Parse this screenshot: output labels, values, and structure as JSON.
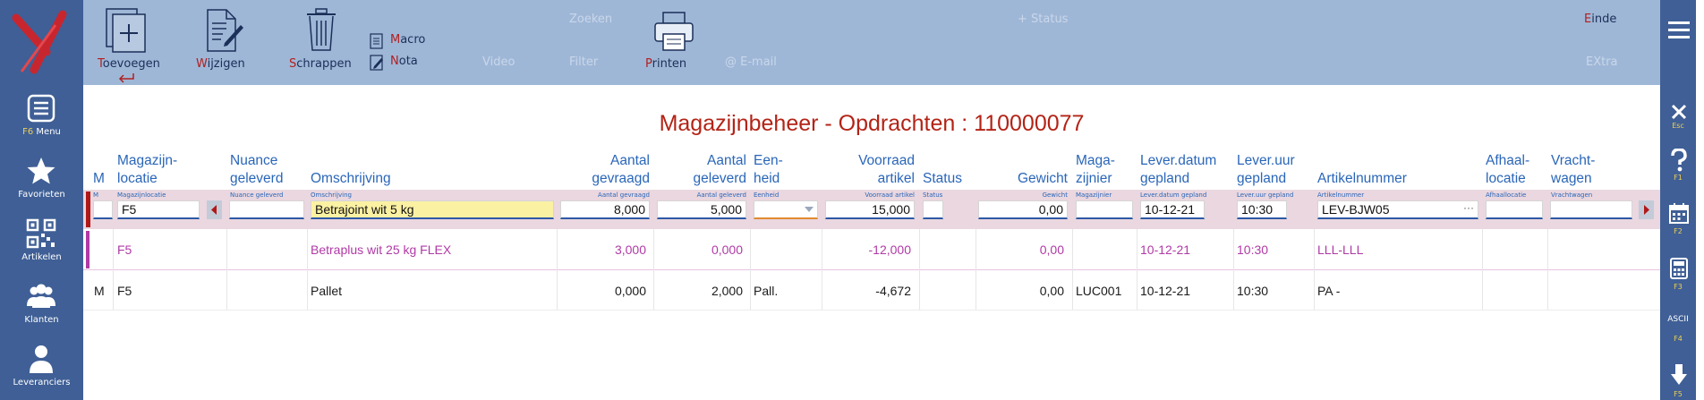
{
  "toolbar": {
    "toevoegen": "Toevoegen",
    "wijzigen": "Wijzigen",
    "schrappen": "Schrappen",
    "macro": "Macro",
    "nota": "Nota",
    "printen": "Printen",
    "einde": "Einde",
    "zoeken": "Zoeken",
    "video": "Video",
    "filter": "Filter",
    "email": "@ E-mail",
    "status": "+ Status",
    "extra": "EXtra"
  },
  "left_nav": [
    {
      "key": "F6",
      "label": "Menu",
      "icon": "menu-icon"
    },
    {
      "label": "Favorieten",
      "icon": "star-icon"
    },
    {
      "label": "Artikelen",
      "icon": "qr-code-icon"
    },
    {
      "label": "Klanten",
      "icon": "people-icon"
    },
    {
      "label": "Leveranciers",
      "icon": "person-icon"
    }
  ],
  "right_nav": [
    {
      "key": "Esc",
      "icon": "close-icon"
    },
    {
      "key": "F1",
      "icon": "help-icon"
    },
    {
      "key": "F2",
      "icon": "calendar-icon"
    },
    {
      "key": "F3",
      "icon": "calculator-icon"
    },
    {
      "key": "F4",
      "label": "ASCII"
    },
    {
      "key": "F5",
      "icon": "arrow-down-icon"
    }
  ],
  "page_title": "Magazijnbeheer - Opdrachten : 110000077",
  "columns": {
    "m": "M",
    "locatie_1": "Magazijn-",
    "locatie_2": "locatie",
    "nuance_1": "Nuance",
    "nuance_2": "geleverd",
    "omschrijving": "Omschrijving",
    "gevraagd_1": "Aantal",
    "gevraagd_2": "gevraagd",
    "geleverd_1": "Aantal",
    "geleverd_2": "geleverd",
    "eenheid_1": "Een-",
    "eenheid_2": "heid",
    "voorraad_1": "Voorraad",
    "voorraad_2": "artikel",
    "status": "Status",
    "gewicht": "Gewicht",
    "magazijnier_1": "Maga-",
    "magazijnier_2": "zijnier",
    "leverdatum_1": "Lever.datum",
    "leverdatum_2": "gepland",
    "leveruur_1": "Lever.uur",
    "leveruur_2": "gepland",
    "artikelnummer": "Artikelnummer",
    "afhaal_1": "Afhaal-",
    "afhaal_2": "locatie",
    "vracht_1": "Vracht-",
    "vracht_2": "wagen"
  },
  "field_labels": {
    "m": "M",
    "locatie": "Magazijnlocatie",
    "nuance": "Nuance geleverd",
    "omschrijving": "Omschrijving",
    "gevraagd": "Aantal gevraagd",
    "geleverd": "Aantal geleverd",
    "eenheid": "Eenheid",
    "voorraad": "Voorraad artikel",
    "status": "Status",
    "gewicht": "Gewicht",
    "magazijnier": "Magazijnier",
    "leverdatum": "Lever.datum gepland",
    "leveruur": "Lever.uur gepland",
    "artikelnummer": "Artikelnummer",
    "afhaal": "Afhaallocatie",
    "vracht": "Vrachtwagen"
  },
  "edit_row": {
    "m": "",
    "locatie": "F5",
    "nuance": "",
    "omschrijving": "Betrajoint wit 5 kg",
    "gevraagd": "8,000",
    "geleverd": "5,000",
    "eenheid": "",
    "voorraad": "15,000",
    "status": "",
    "gewicht": "0,00",
    "magazijnier": "",
    "leverdatum": "10-12-21",
    "leveruur": "10:30",
    "artikelnummer": "LEV-BJW05",
    "afhaal": "",
    "vracht": ""
  },
  "rows": [
    {
      "m": "",
      "locatie": "F5",
      "omschrijving": "Betraplus wit 25 kg FLEX",
      "gevraagd": "3,000",
      "geleverd": "0,000",
      "eenheid": "",
      "voorraad": "-12,000",
      "gewicht": "0,00",
      "magazijnier": "",
      "leverdatum": "10-12-21",
      "leveruur": "10:30",
      "artikelnummer": "LLL-LLL"
    },
    {
      "m": "M",
      "locatie": "F5",
      "omschrijving": "Pallet",
      "gevraagd": "0,000",
      "geleverd": "2,000",
      "eenheid": "Pall.",
      "voorraad": "-4,672",
      "gewicht": "0,00",
      "magazijnier": "LUC001",
      "leverdatum": "10-12-21",
      "leveruur": "10:30",
      "artikelnummer": "PA -"
    }
  ],
  "colors": {
    "sidebar": "#3f5f96",
    "toolbar": "#9fb7d7",
    "title": "#b32316",
    "header": "#2a66b8",
    "edit_row_bg": "#ead7df",
    "row2_text": "#b03aa6"
  }
}
